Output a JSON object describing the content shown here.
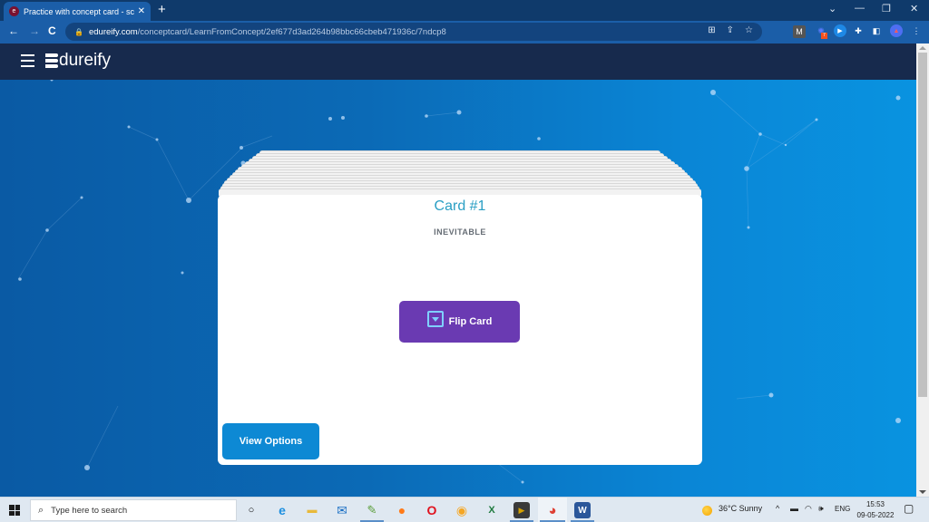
{
  "browser": {
    "tab_title": "Practice with concept card - sco",
    "favicon_letter": "e",
    "tab_close": "✕",
    "new_tab": "+",
    "window_controls": {
      "tabsearch": "⌄",
      "minimize": "—",
      "restore": "❐",
      "close": "✕"
    },
    "nav": {
      "back": "←",
      "forward": "→",
      "reload": "C"
    },
    "url_host": "edureify.com",
    "url_path": "/conceptcard/LearnFromConcept/2ef677d3ad264b98bbc66cbeb471936c/7ndcp8",
    "omnibox_icons": {
      "translate": "⊞",
      "share": "⇪",
      "bookmark": "☆"
    },
    "extensions": [
      {
        "name": "m-extension",
        "glyph": "M",
        "color": "#555555"
      },
      {
        "name": "gear-extension",
        "glyph": "✺",
        "color": "#3d5afe",
        "badge": "7"
      },
      {
        "name": "play-extension",
        "glyph": "▶",
        "color": "#1e88e5"
      },
      {
        "name": "puzzle-extension",
        "glyph": "✚",
        "color": "#ffffff"
      },
      {
        "name": "sidepanel",
        "glyph": "◧",
        "color": "#ffffff"
      },
      {
        "name": "profile",
        "glyph": "▲",
        "color": "#4e6ef2"
      },
      {
        "name": "menu",
        "glyph": "⋮",
        "color": "#ffffff"
      }
    ]
  },
  "app": {
    "logo_text": "dureify",
    "card": {
      "title": "Card #1",
      "word": "INEVITABLE",
      "flip_label": "Flip Card",
      "view_options_label": "View Options"
    },
    "colors": {
      "header": "#172a4d",
      "card_title": "#2a9fc4",
      "flip_button": "#6a3ab2",
      "view_options_button": "#0d89d4"
    }
  },
  "taskbar": {
    "search_placeholder": "Type here to search",
    "apps": [
      {
        "name": "cortana",
        "glyph": "○",
        "color": "#111111"
      },
      {
        "name": "edge",
        "glyph": "e",
        "color": "#1d8fe0"
      },
      {
        "name": "file-explorer",
        "glyph": "▬",
        "color": "#e8b93a"
      },
      {
        "name": "mail",
        "glyph": "✉",
        "color": "#1a6fc4"
      },
      {
        "name": "notepad-plus",
        "glyph": "✎",
        "color": "#5a9e3a"
      },
      {
        "name": "firefox",
        "glyph": "●",
        "color": "#ff7a18"
      },
      {
        "name": "opera",
        "glyph": "O",
        "color": "#e0121e"
      },
      {
        "name": "brave-like",
        "glyph": "◉",
        "color": "#f5a623"
      },
      {
        "name": "excel",
        "glyph": "X",
        "color": "#1e7a3e"
      },
      {
        "name": "media-player",
        "glyph": "▶",
        "color": "#d4a000"
      },
      {
        "name": "chrome",
        "glyph": "◕",
        "color": "#de4034"
      },
      {
        "name": "word",
        "glyph": "W",
        "color": "#2b579a"
      }
    ],
    "weather": "36°C  Sunny",
    "tray": {
      "chevron": "^",
      "battery": "▬",
      "wifi": "◠",
      "volume": "🕪",
      "lang": "ENG"
    },
    "time": "15:53",
    "date": "09-05-2022",
    "notification": "▢"
  }
}
